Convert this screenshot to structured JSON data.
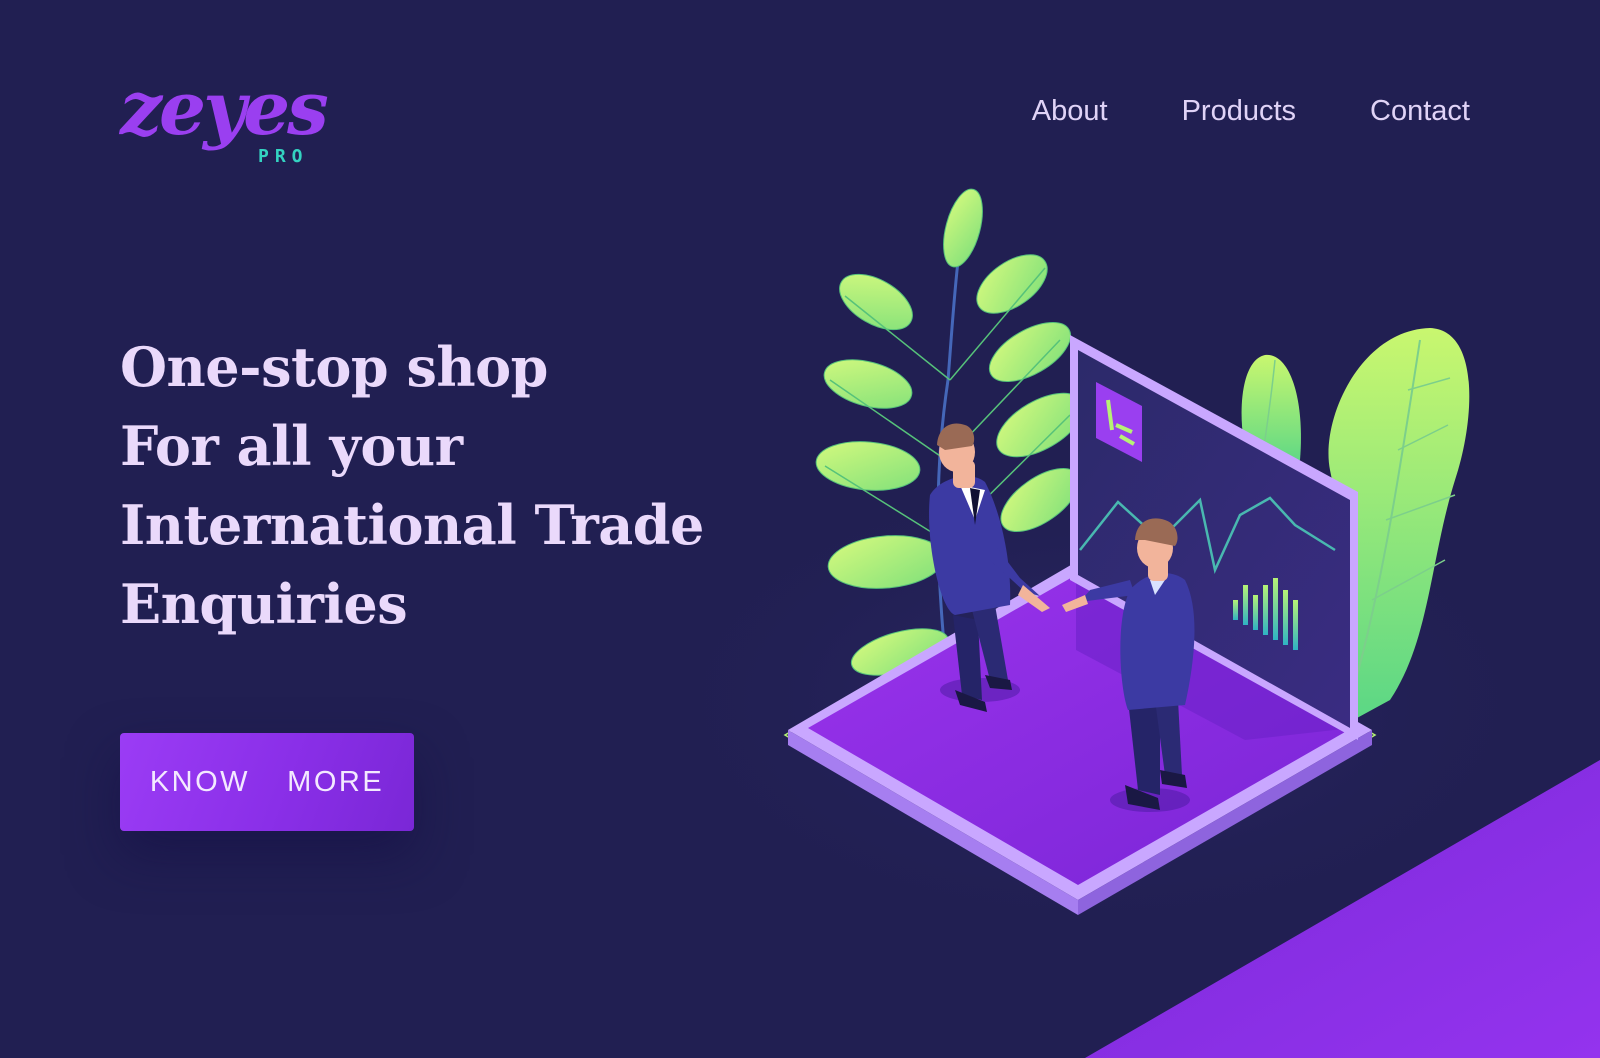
{
  "brand": {
    "name": "zeyes",
    "sub": "PRO"
  },
  "nav": {
    "items": [
      {
        "label": "About"
      },
      {
        "label": "Products"
      },
      {
        "label": "Contact"
      }
    ]
  },
  "hero": {
    "lines": [
      "One-stop shop",
      "For all your",
      "International Trade",
      "Enquiries"
    ],
    "cta_label": "KNOW  MORE"
  },
  "colors": {
    "background": "#211f52",
    "accent": "#9b3cf5",
    "heading": "#ead9fb",
    "leaf_green": "#b5f36a",
    "logo_sub": "#34d3c1"
  },
  "icons": {
    "illustration": "business-handshake-illustration"
  }
}
